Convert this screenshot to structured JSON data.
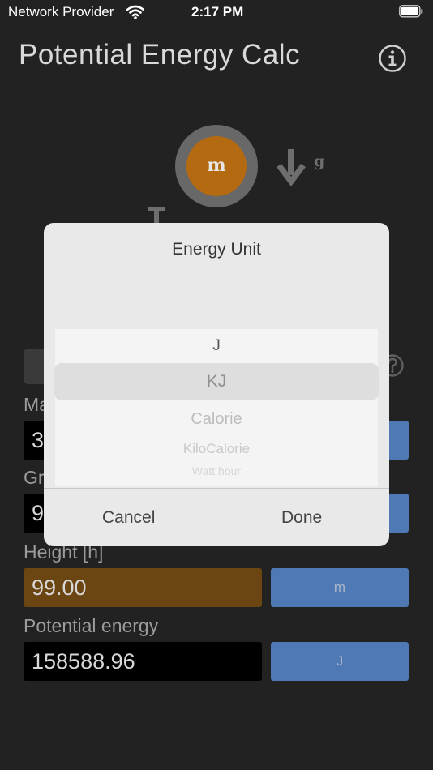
{
  "status_bar": {
    "carrier": "Network Provider",
    "time": "2:17 PM"
  },
  "header": {
    "title": "Potential Energy Calc"
  },
  "diagram": {
    "mass_label": "m",
    "gravity_label": "g"
  },
  "form": {
    "mass_label": "Ma",
    "mass_value": "3",
    "gravity_label": "Gr",
    "gravity_value": "9",
    "height_label": "Height [h]",
    "height_value": "99.00",
    "height_unit": "m",
    "energy_label": "Potential energy",
    "energy_value": "158588.96",
    "energy_unit": "J"
  },
  "picker_modal": {
    "title": "Energy Unit",
    "options": [
      "J",
      "KJ",
      "Calorie",
      "KiloCalorie",
      "Watt hour"
    ],
    "selected": "KJ",
    "cancel_label": "Cancel",
    "done_label": "Done"
  },
  "colors": {
    "background": "#222222",
    "mass_ball": "#b46a10",
    "unit_button": "#4f79b4",
    "height_field": "#6b4512",
    "modal": "#e9e9e9"
  }
}
